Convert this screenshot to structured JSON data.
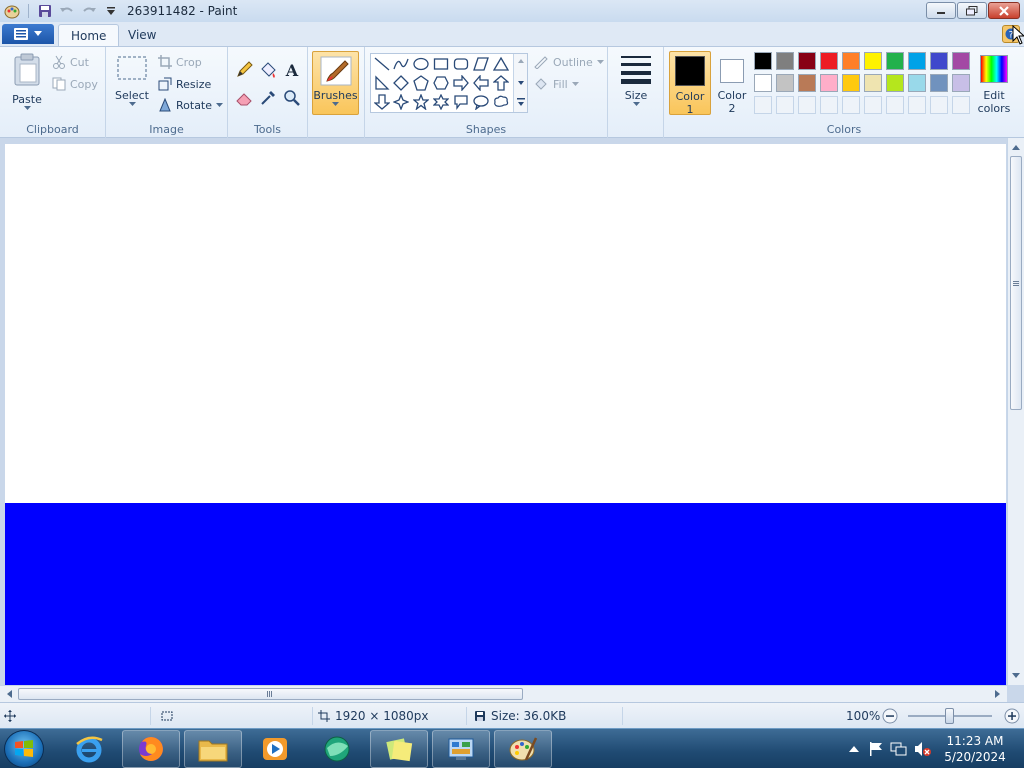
{
  "window": {
    "title": "263911482 - Paint"
  },
  "tabs": [
    {
      "label": "Home"
    },
    {
      "label": "View"
    }
  ],
  "ribbon": {
    "clipboard": {
      "label": "Clipboard",
      "paste": "Paste",
      "cut": "Cut",
      "copy": "Copy"
    },
    "image": {
      "label": "Image",
      "select": "Select",
      "crop": "Crop",
      "resize": "Resize",
      "rotate": "Rotate"
    },
    "tools": {
      "label": "Tools"
    },
    "brushes": {
      "label": "Brushes"
    },
    "shapes": {
      "label": "Shapes",
      "outline": "Outline",
      "fill": "Fill"
    },
    "size": {
      "label": "Size"
    },
    "colors": {
      "label": "Colors",
      "color1_line1": "Color",
      "color1_line2": "1",
      "color2_line1": "Color",
      "color2_line2": "2",
      "edit_line1": "Edit",
      "edit_line2": "colors",
      "color1": "#000000",
      "color2": "#ffffff",
      "palette_row1": [
        "#000000",
        "#7f7f7f",
        "#880015",
        "#ed1c24",
        "#ff7f27",
        "#fff200",
        "#22b14c",
        "#00a2e8",
        "#3f48cc",
        "#a349a4"
      ],
      "palette_row2": [
        "#ffffff",
        "#c3c3c3",
        "#b97a57",
        "#ffaec9",
        "#ffc90e",
        "#efe4b0",
        "#b5e61d",
        "#99d9ea",
        "#7092be",
        "#c8bfe7"
      ]
    }
  },
  "canvas": {
    "fill_color": "#0000ff",
    "background": "#ffffff"
  },
  "statusbar": {
    "dimensions": "1920 × 1080px",
    "size": "Size: 36.0KB",
    "zoom": "100%"
  },
  "taskbar": {
    "time": "11:23 AM",
    "date": "5/20/2024"
  }
}
